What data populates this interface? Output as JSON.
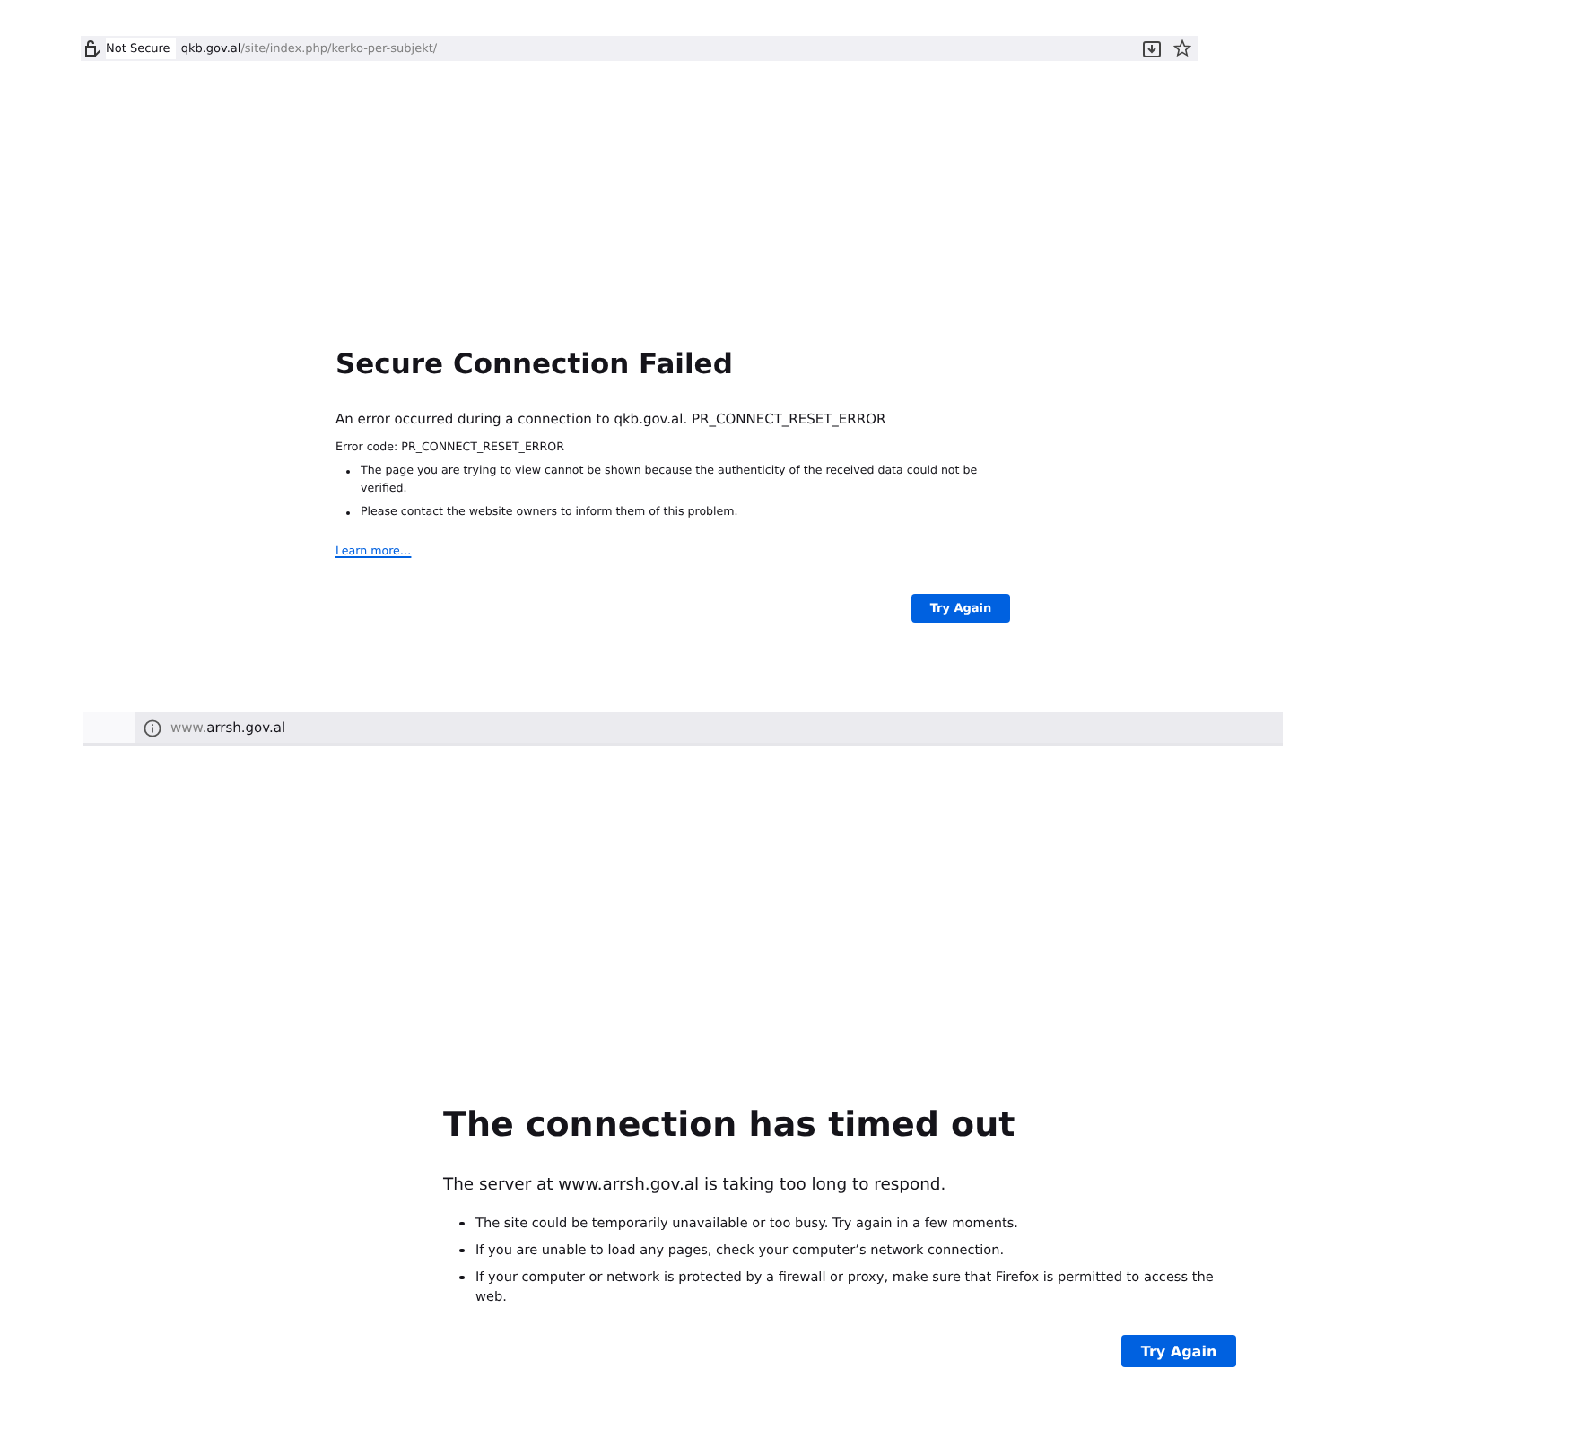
{
  "pages": [
    {
      "kind": "cert",
      "address": {
        "security": "Not Secure",
        "host": "qkb.gov.al",
        "path": "/site/index.php/kerko-per-subjekt/"
      },
      "title": "Secure Connection Failed",
      "description": "An error occurred during a connection to qkb.gov.al. PR_CONNECT_RESET_ERROR",
      "error_code": "Error code: PR_CONNECT_RESET_ERROR",
      "bullets": [
        "The page you are trying to view cannot be shown because the authenticity of the received data could not be verified.",
        "Please contact the website owners to inform them of this problem."
      ],
      "link": "Learn more…",
      "button": "Try Again"
    },
    {
      "kind": "timeout",
      "address": {
        "prefix": "www.",
        "host": "arrsh.gov.al"
      },
      "title": "The connection has timed out",
      "description": "The server at www.arrsh.gov.al is taking too long to respond.",
      "bullets": [
        "The site could be temporarily unavailable or too busy. Try again in a few moments.",
        "If you are unable to load any pages, check your computer’s network connection.",
        "If your computer or network is protected by a firewall or proxy, make sure that Firefox is permitted to access the web."
      ],
      "button": "Try Again"
    }
  ]
}
